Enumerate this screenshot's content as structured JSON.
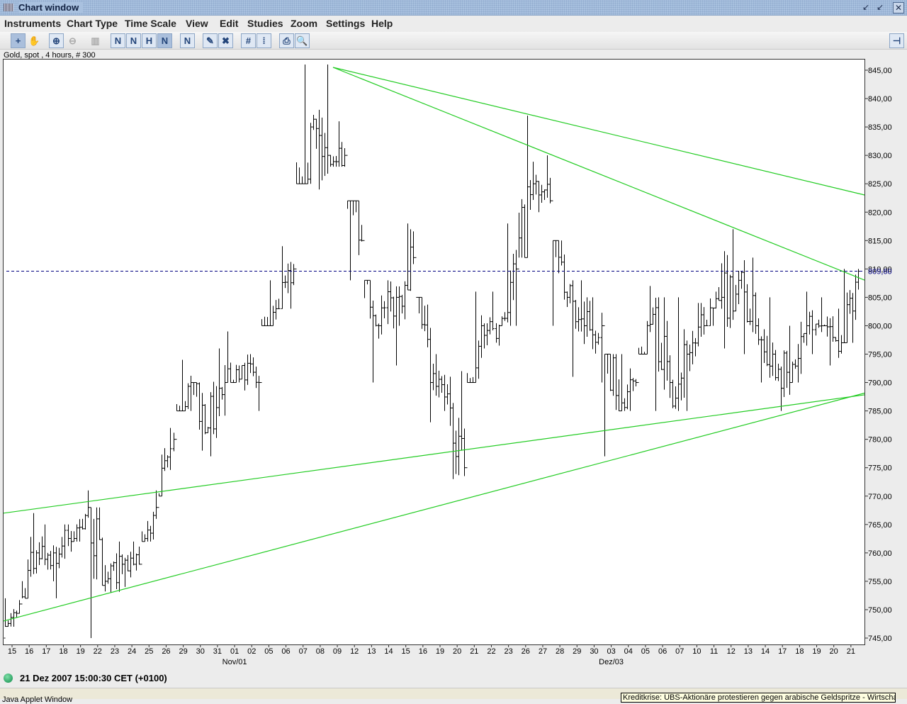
{
  "window": {
    "title": "Chart window",
    "controls": [
      "minimize-icon",
      "restore-icon",
      "close-icon"
    ]
  },
  "menu": [
    "Instruments",
    "Chart Type",
    "Time Scale",
    "View",
    "Edit",
    "Studies",
    "Zoom",
    "Settings",
    "Help"
  ],
  "toolbar": {
    "buttons": [
      "crosshair-icon",
      "pan-icon",
      "zoom-in-icon",
      "zoom-out-icon",
      "volume-chart-icon",
      "trendline-icon",
      "parallel-lines-icon",
      "channel-icon",
      "fan-lines-icon",
      "delete-line-icon",
      "eraser-icon",
      "delete-all-icon",
      "grid-icon",
      "price-scale-icon",
      "print-icon",
      "print-preview-icon"
    ],
    "pin": "pin-icon"
  },
  "chart_info": "Gold, spot , 4 hours, # 300",
  "status": {
    "indicator_color": "#1a9a5a",
    "time": "21 Dez 2007 15:00:30  CET (+0100)"
  },
  "applet_label": "Java Applet Window",
  "tooltip": "Kreditkrise: UBS-Aktionäre protestieren gegen arabische Geldspritze - Wirtschaf",
  "chart_data": {
    "type": "ohlc",
    "title": "Gold, spot , 4 hours, # 300",
    "ylim": [
      744,
      847
    ],
    "yticks": [
      "845,00",
      "840,00",
      "835,00",
      "830,00",
      "825,00",
      "820,00",
      "815,00",
      "810,00",
      "805,00",
      "800,00",
      "795,00",
      "790,00",
      "785,00",
      "780,00",
      "775,00",
      "770,00",
      "765,00",
      "760,00",
      "755,00",
      "750,00",
      "745,00"
    ],
    "xtick_labels": [
      "15",
      "16",
      "17",
      "18",
      "19",
      "22",
      "23",
      "24",
      "25",
      "26",
      "29",
      "30",
      "31",
      "01",
      "02",
      "05",
      "06",
      "07",
      "08",
      "09",
      "12",
      "13",
      "14",
      "15",
      "16",
      "19",
      "20",
      "21",
      "22",
      "23",
      "26",
      "27",
      "28",
      "29",
      "30",
      "03",
      "04",
      "05",
      "06",
      "07",
      "10",
      "11",
      "12",
      "13",
      "14",
      "17",
      "18",
      "19",
      "20",
      "21"
    ],
    "month_labels": [
      {
        "at": "01",
        "index": 13,
        "label": "Nov/01"
      },
      {
        "at": "03",
        "index": 35,
        "label": "Dez/03"
      }
    ],
    "daily_bars": [
      [
        "2007-10-15",
        752,
        747,
        751
      ],
      [
        "2007-10-16",
        767,
        752,
        760
      ],
      [
        "2007-10-17",
        765,
        755,
        760
      ],
      [
        "2007-10-18",
        765,
        752,
        762
      ],
      [
        "2007-10-19",
        771,
        762,
        768
      ],
      [
        "2007-10-22",
        768,
        745,
        755
      ],
      [
        "2007-10-23",
        762,
        753,
        758
      ],
      [
        "2007-10-24",
        762,
        754,
        758
      ],
      [
        "2007-10-25",
        771,
        762,
        768
      ],
      [
        "2007-10-26",
        782,
        770,
        780
      ],
      [
        "2007-10-29",
        794,
        785,
        790
      ],
      [
        "2007-10-30",
        790,
        778,
        782
      ],
      [
        "2007-10-31",
        796,
        777,
        790
      ],
      [
        "2007-11-01",
        799,
        790,
        793
      ],
      [
        "2007-11-02",
        795,
        785,
        790
      ],
      [
        "2007-11-05",
        808,
        800,
        803
      ],
      [
        "2007-11-06",
        814,
        803,
        810
      ],
      [
        "2007-11-07",
        846,
        825,
        835
      ],
      [
        "2007-11-08",
        846,
        824,
        830
      ],
      [
        "2007-11-09",
        836,
        828,
        830
      ],
      [
        "2007-11-12",
        822,
        808,
        815
      ],
      [
        "2007-11-13",
        808,
        790,
        800
      ],
      [
        "2007-11-14",
        808,
        793,
        805
      ],
      [
        "2007-11-15",
        818,
        800,
        812
      ],
      [
        "2007-11-16",
        805,
        783,
        790
      ],
      [
        "2007-11-19",
        795,
        785,
        788
      ],
      [
        "2007-11-20",
        792,
        773,
        775
      ],
      [
        "2007-11-21",
        806,
        790,
        800
      ],
      [
        "2007-11-22",
        806,
        796,
        800
      ],
      [
        "2007-11-23",
        818,
        800,
        810
      ],
      [
        "2007-11-26",
        837,
        812,
        825
      ],
      [
        "2007-11-27",
        830,
        820,
        822
      ],
      [
        "2007-11-28",
        815,
        800,
        805
      ],
      [
        "2007-11-29",
        808,
        791,
        800
      ],
      [
        "2007-11-30",
        805,
        790,
        800
      ],
      [
        "2007-12-03",
        795,
        777,
        785
      ],
      [
        "2007-12-04",
        795,
        785,
        790
      ],
      [
        "2007-12-05",
        807,
        795,
        802
      ],
      [
        "2007-12-06",
        805,
        785,
        790
      ],
      [
        "2007-12-07",
        805,
        785,
        795
      ],
      [
        "2007-12-10",
        804,
        792,
        800
      ],
      [
        "2007-12-11",
        811,
        800,
        805
      ],
      [
        "2007-12-12",
        817,
        796,
        808
      ],
      [
        "2007-12-13",
        812,
        795,
        800
      ],
      [
        "2007-12-14",
        805,
        790,
        795
      ],
      [
        "2007-12-17",
        800,
        785,
        790
      ],
      [
        "2007-12-18",
        806,
        790,
        800
      ],
      [
        "2007-12-19",
        805,
        795,
        800
      ],
      [
        "2007-12-20",
        803,
        793,
        797
      ],
      [
        "2007-12-21",
        810,
        797,
        809.6
      ]
    ],
    "last_price": {
      "value": 809.6,
      "label": "809,60",
      "color": "#000080"
    },
    "trendlines": {
      "color": "#22cc22",
      "lines": [
        {
          "p1": [
            18.75,
            845.5
          ],
          "p2": [
            49,
            823.6
          ],
          "extend": "right"
        },
        {
          "p1": [
            18.75,
            845.5
          ],
          "p2": [
            49,
            809
          ],
          "extend": "right"
        },
        {
          "p1": [
            0,
            767.2
          ],
          "p2": [
            49,
            787.5
          ],
          "extend": "both"
        },
        {
          "p1": [
            0,
            748.4
          ],
          "p2": [
            49,
            787.5
          ],
          "extend": "both"
        }
      ]
    }
  }
}
